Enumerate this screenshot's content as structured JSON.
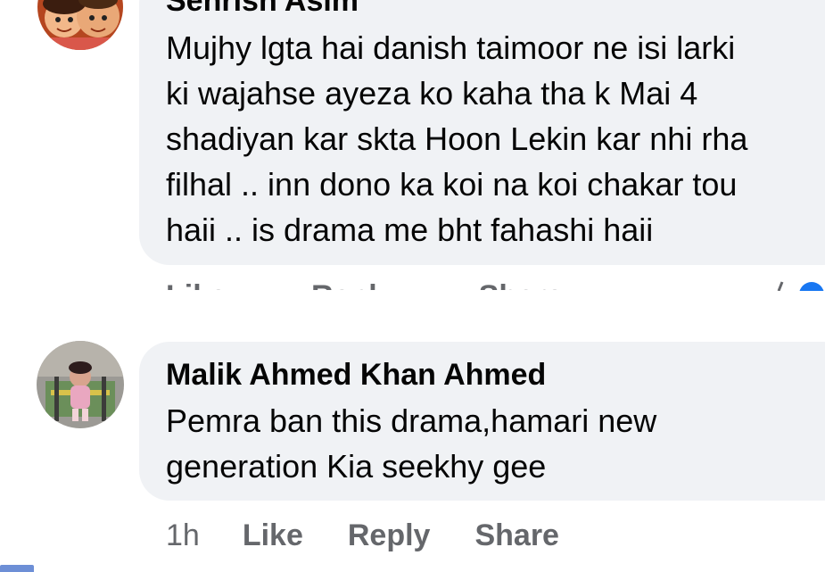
{
  "comments": [
    {
      "author": "Sehrish Asim",
      "text": "Mujhy lgta hai danish taimoor ne isi larki\nki wajahse ayeza ko kaha tha k Mai 4\nshadiyan kar skta Hoon Lekin kar nhi rha\nfilhal .. inn dono ka koi na koi chakar tou\nhaii .. is drama me bht fahashi haii",
      "actions": [
        "Like",
        "Reply",
        "Share"
      ],
      "avatar_icon": "cartoon-kids-avatar-icon"
    },
    {
      "author": "Malik Ahmed Khan Ahmed",
      "text": "Pemra ban this drama,hamari new\ngeneration Kia seekhy gee",
      "timestamp": "1h",
      "actions": [
        "Like",
        "Reply",
        "Share"
      ],
      "avatar_icon": "child-photo-avatar-icon"
    }
  ],
  "colors": {
    "bubble": "#f0f2f5",
    "text": "#050505",
    "secondary": "#65676b",
    "reaction_blue": "#1877f2"
  }
}
